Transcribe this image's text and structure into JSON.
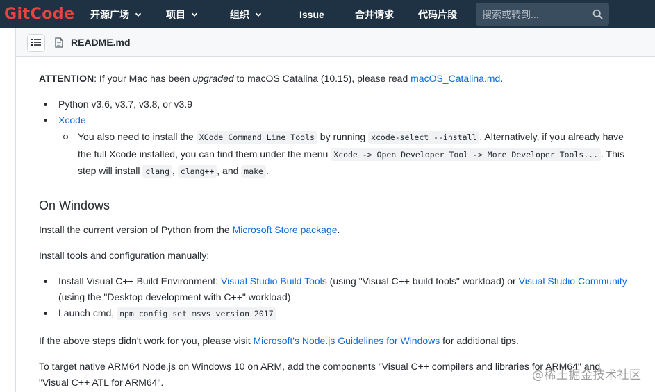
{
  "nav": {
    "logo": "GitCode",
    "items": [
      {
        "label": "开源广场",
        "dropdown": true
      },
      {
        "label": "项目",
        "dropdown": true
      },
      {
        "label": "组织",
        "dropdown": true
      },
      {
        "label": "Issue",
        "dropdown": false
      },
      {
        "label": "合并请求",
        "dropdown": false
      },
      {
        "label": "代码片段",
        "dropdown": false
      }
    ],
    "search_placeholder": "搜索或转到..."
  },
  "file": {
    "name": "README.md"
  },
  "readme": {
    "attention": {
      "strong": "ATTENTION",
      "t1": ": If your Mac has been ",
      "em": "upgraded",
      "t2": " to macOS Catalina (10.15), please read ",
      "link": "macOS_Catalina.md",
      "t3": "."
    },
    "mac_list": {
      "python": "Python v3.6, v3.7, v3.8, or v3.9",
      "xcode_link": "Xcode",
      "sub": {
        "t1": "You also need to install the ",
        "code1": "XCode Command Line Tools",
        "t2": " by running ",
        "code2": "xcode-select --install",
        "t3": ". Alternatively, if you already have the full Xcode installed, you can find them under the menu ",
        "code3": "Xcode -> Open Developer Tool -> More Developer Tools...",
        "t4": ". This step will install ",
        "code4": "clang",
        "t5": ", ",
        "code5": "clang++",
        "t6": ", and ",
        "code6": "make",
        "t7": "."
      }
    },
    "windows_heading": "On Windows",
    "install_python": {
      "t1": "Install the current version of Python from the ",
      "link": "Microsoft Store package",
      "t2": "."
    },
    "install_tools": "Install tools and configuration manually:",
    "win_list": {
      "item1": {
        "t1": "Install Visual C++ Build Environment: ",
        "link1": "Visual Studio Build Tools",
        "t2": " (using \"Visual C++ build tools\" workload) or ",
        "link2": "Visual Studio Community",
        "t3": " (using the \"Desktop development with C++\" workload)"
      },
      "item2": {
        "t1": "Launch cmd, ",
        "code": "npm config set msvs_version 2017"
      }
    },
    "tips": {
      "t1": "If the above steps didn't work for you, please visit ",
      "link": "Microsoft's Node.js Guidelines for Windows",
      "t2": " for additional tips."
    },
    "arm": "To target native ARM64 Node.js on Windows 10 on ARM, add the components \"Visual C++ compilers and libraries for ARM64\" and \"Visual C++ ATL for ARM64\"."
  },
  "watermark": "@稀土掘金技术社区",
  "colors": {
    "nav_bg": "#1f3244",
    "logo": "#e8433e",
    "link": "#0969da",
    "text": "#24292f"
  }
}
